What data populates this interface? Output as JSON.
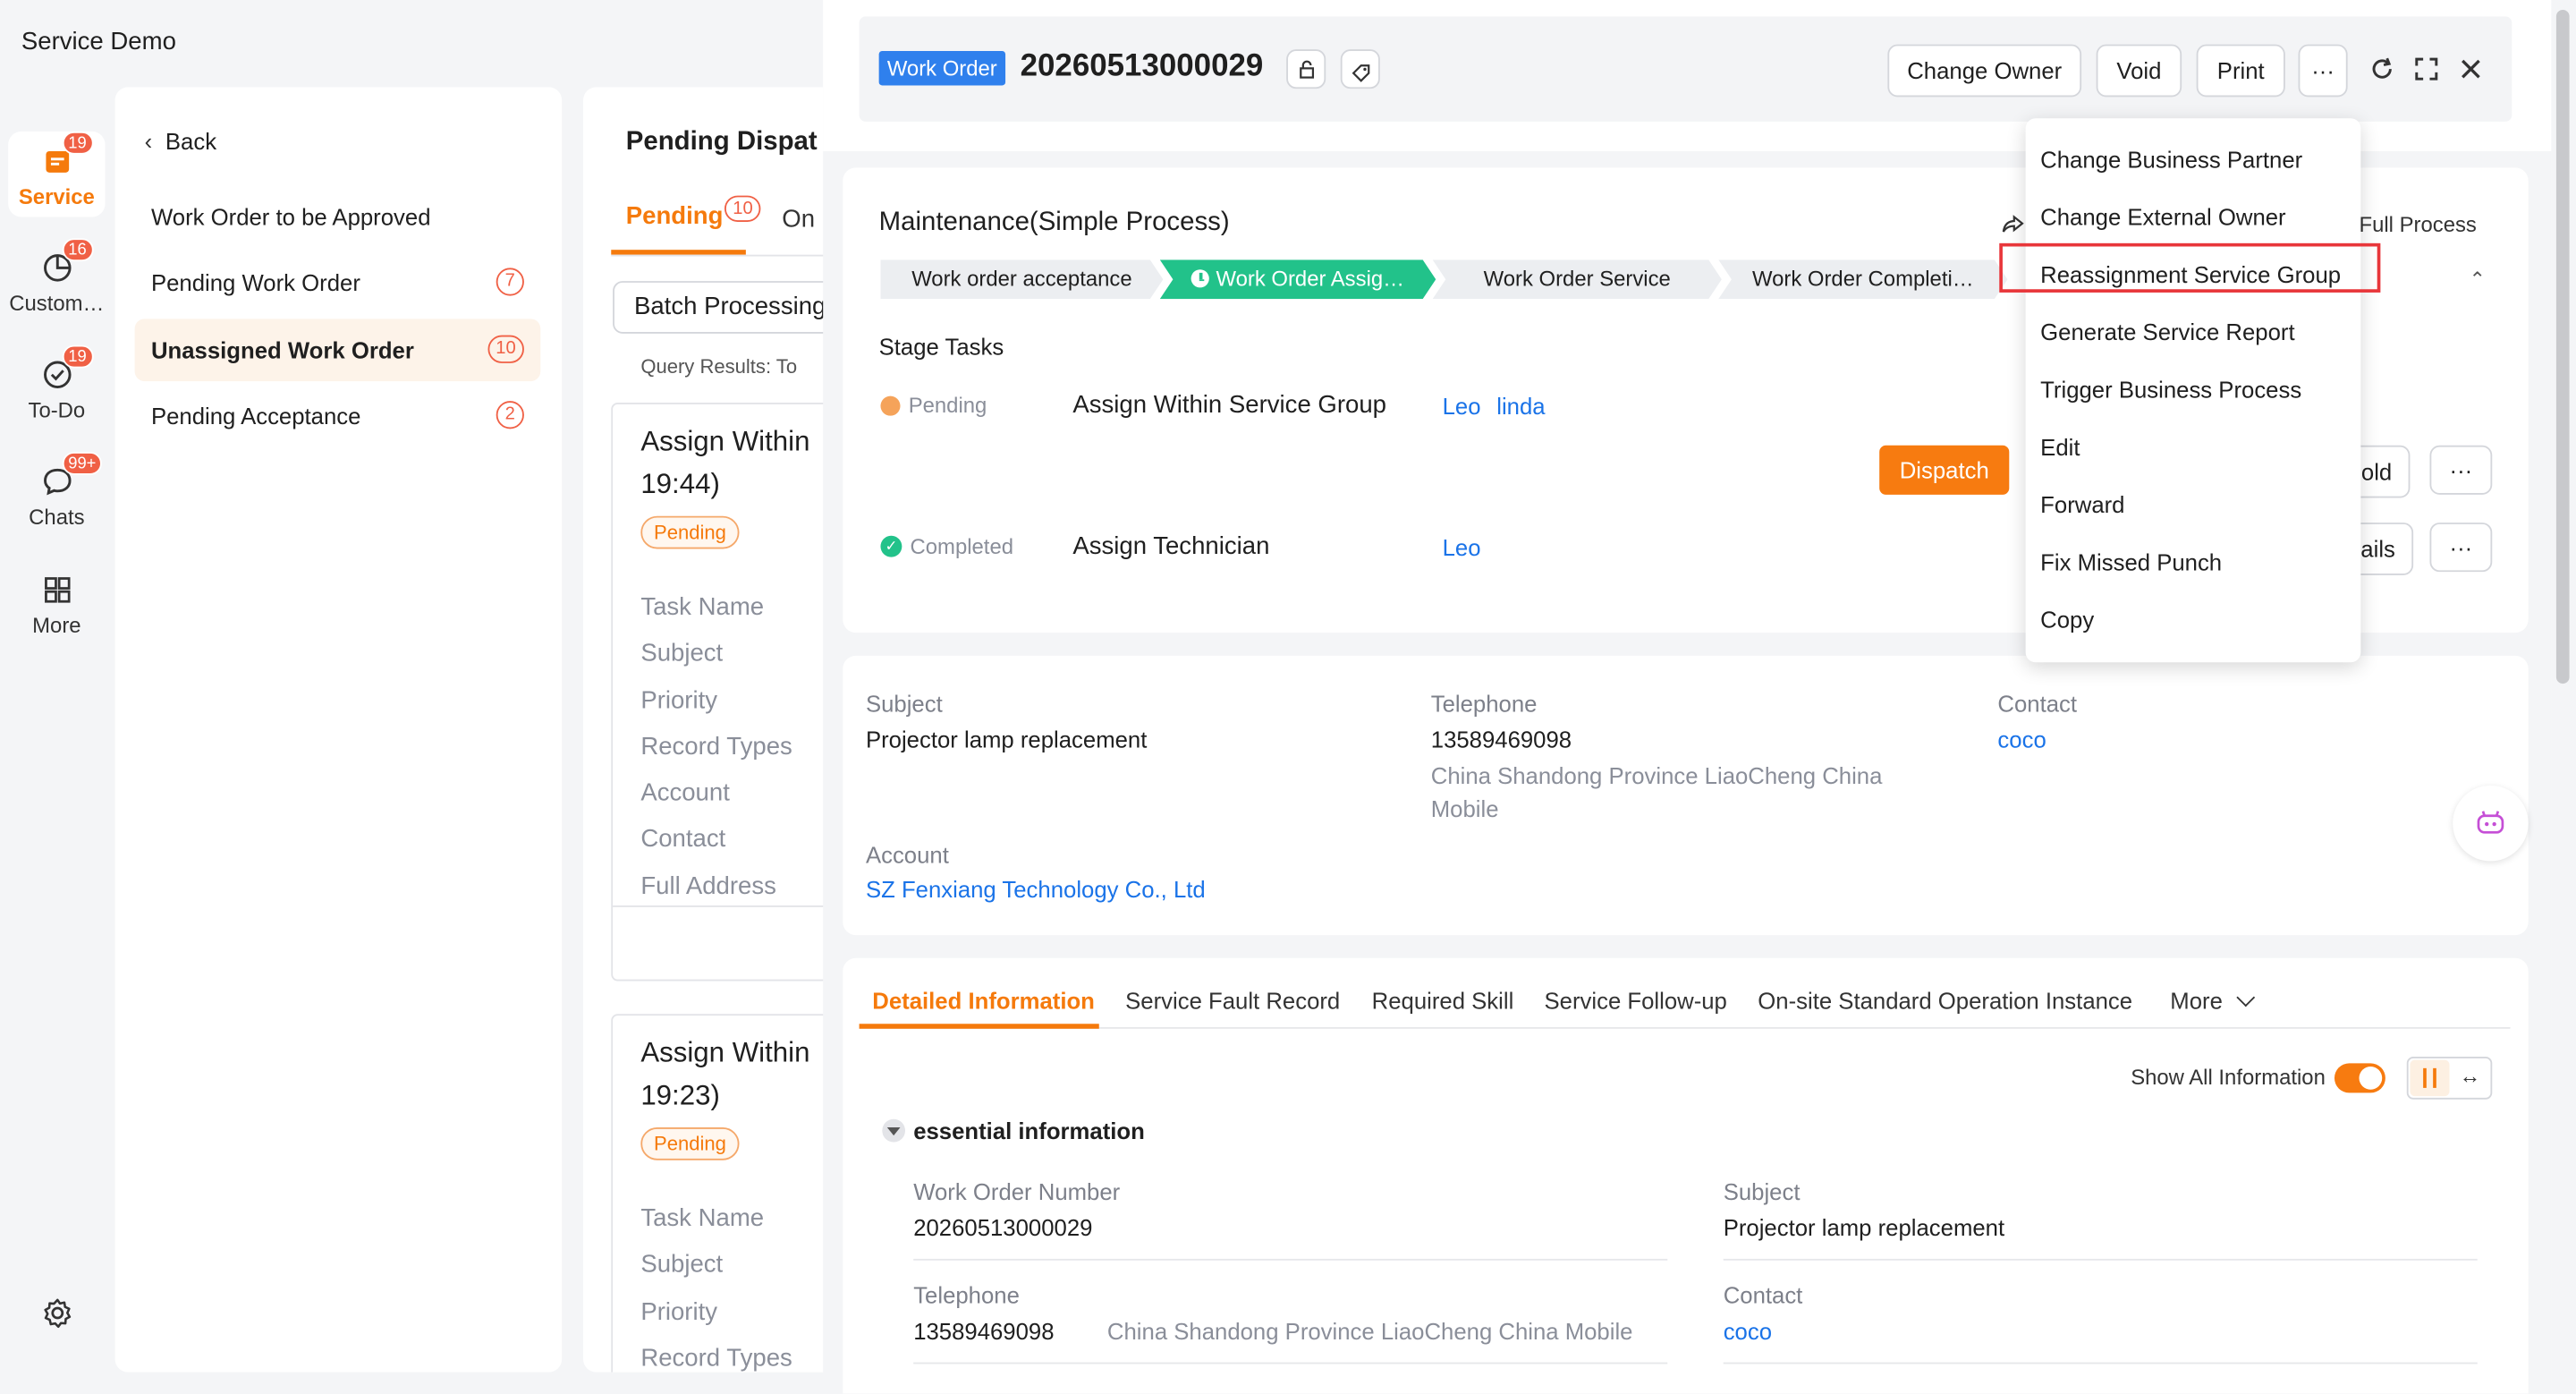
{
  "app": {
    "title": "Service Demo"
  },
  "rail": [
    {
      "label": "Service",
      "icon": "service-icon",
      "badge": "19"
    },
    {
      "label": "Custom…",
      "icon": "pie-chart-icon",
      "badge": "16"
    },
    {
      "label": "To-Do",
      "icon": "check-circle-icon",
      "badge": "19"
    },
    {
      "label": "Chats",
      "icon": "chat-bubble-icon",
      "badge": "99+"
    },
    {
      "label": "More",
      "icon": "grid-icon",
      "badge": ""
    }
  ],
  "nav": {
    "back": "Back",
    "items": [
      {
        "label": "Work Order to be Approved",
        "count": ""
      },
      {
        "label": "Pending Work Order",
        "count": "7"
      },
      {
        "label": "Unassigned Work Order",
        "count": "10"
      },
      {
        "label": "Pending Acceptance",
        "count": "2"
      }
    ]
  },
  "list": {
    "title": "Pending Dispat",
    "tab_pending": "Pending",
    "tab_pending_count": "10",
    "tab_other": "On",
    "batch": "Batch Processing",
    "query": "Query Results: To",
    "cards": [
      {
        "title1": "Assign Within",
        "title2": "19:44)",
        "status": "Pending",
        "fields": [
          "Task Name",
          "Subject",
          "Priority",
          "Record Types",
          "Account",
          "Contact",
          "Full Address"
        ]
      },
      {
        "title1": "Assign Within",
        "title2": "19:23)",
        "status": "Pending",
        "fields": [
          "Task Name",
          "Subject",
          "Priority",
          "Record Types"
        ]
      }
    ]
  },
  "header": {
    "badge": "Work Order",
    "number": "20260513000029",
    "buttons": {
      "change_owner": "Change Owner",
      "void": "Void",
      "print": "Print",
      "more": "···"
    }
  },
  "process": {
    "title": "Maintenance(Simple Process)",
    "full_process": "Full Process",
    "stages": [
      "Work order acceptance",
      "Work Order Assig…",
      "Work Order Service",
      "Work Order Completi…"
    ],
    "stage_tasks": "Stage Tasks",
    "tasks": [
      {
        "status": "Pending",
        "name": "Assign Within Service Group",
        "users": [
          "Leo",
          "linda"
        ]
      },
      {
        "status": "Completed",
        "name": "Assign Technician",
        "users": [
          "Leo"
        ]
      }
    ],
    "dispatch": "Dispatch",
    "hold_tail": "old",
    "details_tail": "ails",
    "more": "···"
  },
  "menu": {
    "items": [
      "Change Business Partner",
      "Change External Owner",
      "Reassignment Service Group",
      "Generate Service Report",
      "Trigger Business Process",
      "Edit",
      "Forward",
      "Fix Missed Punch",
      "Copy"
    ],
    "highlight_color": "#e8363a"
  },
  "summary": {
    "subject_label": "Subject",
    "subject": "Projector lamp replacement",
    "telephone_label": "Telephone",
    "telephone": "13589469098",
    "address1": "China Shandong Province LiaoCheng China",
    "address2": "Mobile",
    "contact_label": "Contact",
    "contact": "coco",
    "account_label": "Account",
    "account": "SZ Fenxiang Technology Co., Ltd"
  },
  "tabs": {
    "items": [
      "Detailed Information",
      "Service Fault Record",
      "Required Skill",
      "Service Follow-up",
      "On-site Standard Operation Instance"
    ],
    "more": "More",
    "show_all": "Show All Information"
  },
  "details": {
    "section": "essential information",
    "wo_label": "Work Order Number",
    "wo": "20260513000029",
    "subject_label": "Subject",
    "subject": "Projector lamp replacement",
    "tel_label": "Telephone",
    "tel": "13589469098",
    "address": "China Shandong Province LiaoCheng China Mobile",
    "contact_label": "Contact",
    "contact": "coco"
  },
  "colors": {
    "accent": "#f57a0c",
    "green": "#22c28a",
    "link": "#1a73e8",
    "badge_blue": "#2f80ed"
  }
}
